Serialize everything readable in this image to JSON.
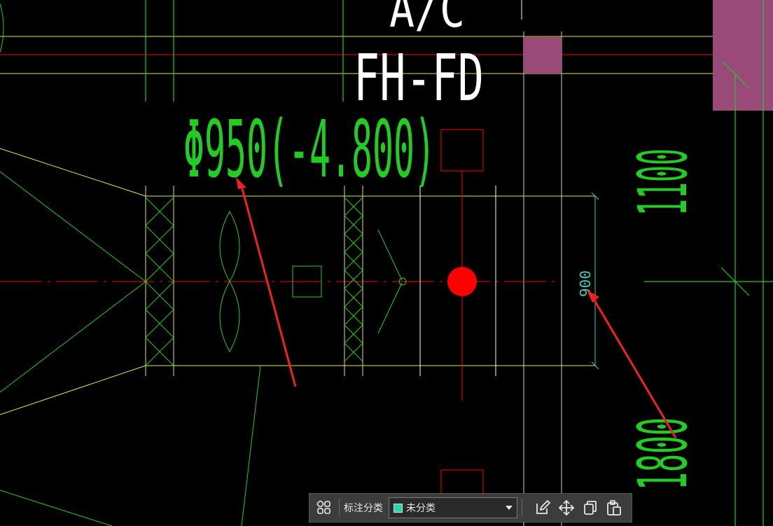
{
  "drawing": {
    "top_text": "A/C",
    "unit_tag": "FH-FD",
    "diameter_label": "Φ950(-4.800)",
    "dim_small": "900",
    "dim_right_top": "1100",
    "dim_right_bottom": "1800",
    "colors": {
      "background": "#000000",
      "green": "#22cc22",
      "yellow": "#e6e64c",
      "red": "#ff0000",
      "white": "#ffffff",
      "magenta_fill": "#9a4a78",
      "cyan_dim": "#40d0c0",
      "arrow_red": "#ee2222"
    }
  },
  "toolbar": {
    "label": "标注分类",
    "category_value": "未分类",
    "category_color": "#2ed3a8",
    "icons": {
      "layout": "category-grid-icon",
      "edit": "edit-icon",
      "move": "move-icon",
      "copy": "copy-icon",
      "paste": "paste-icon"
    }
  }
}
